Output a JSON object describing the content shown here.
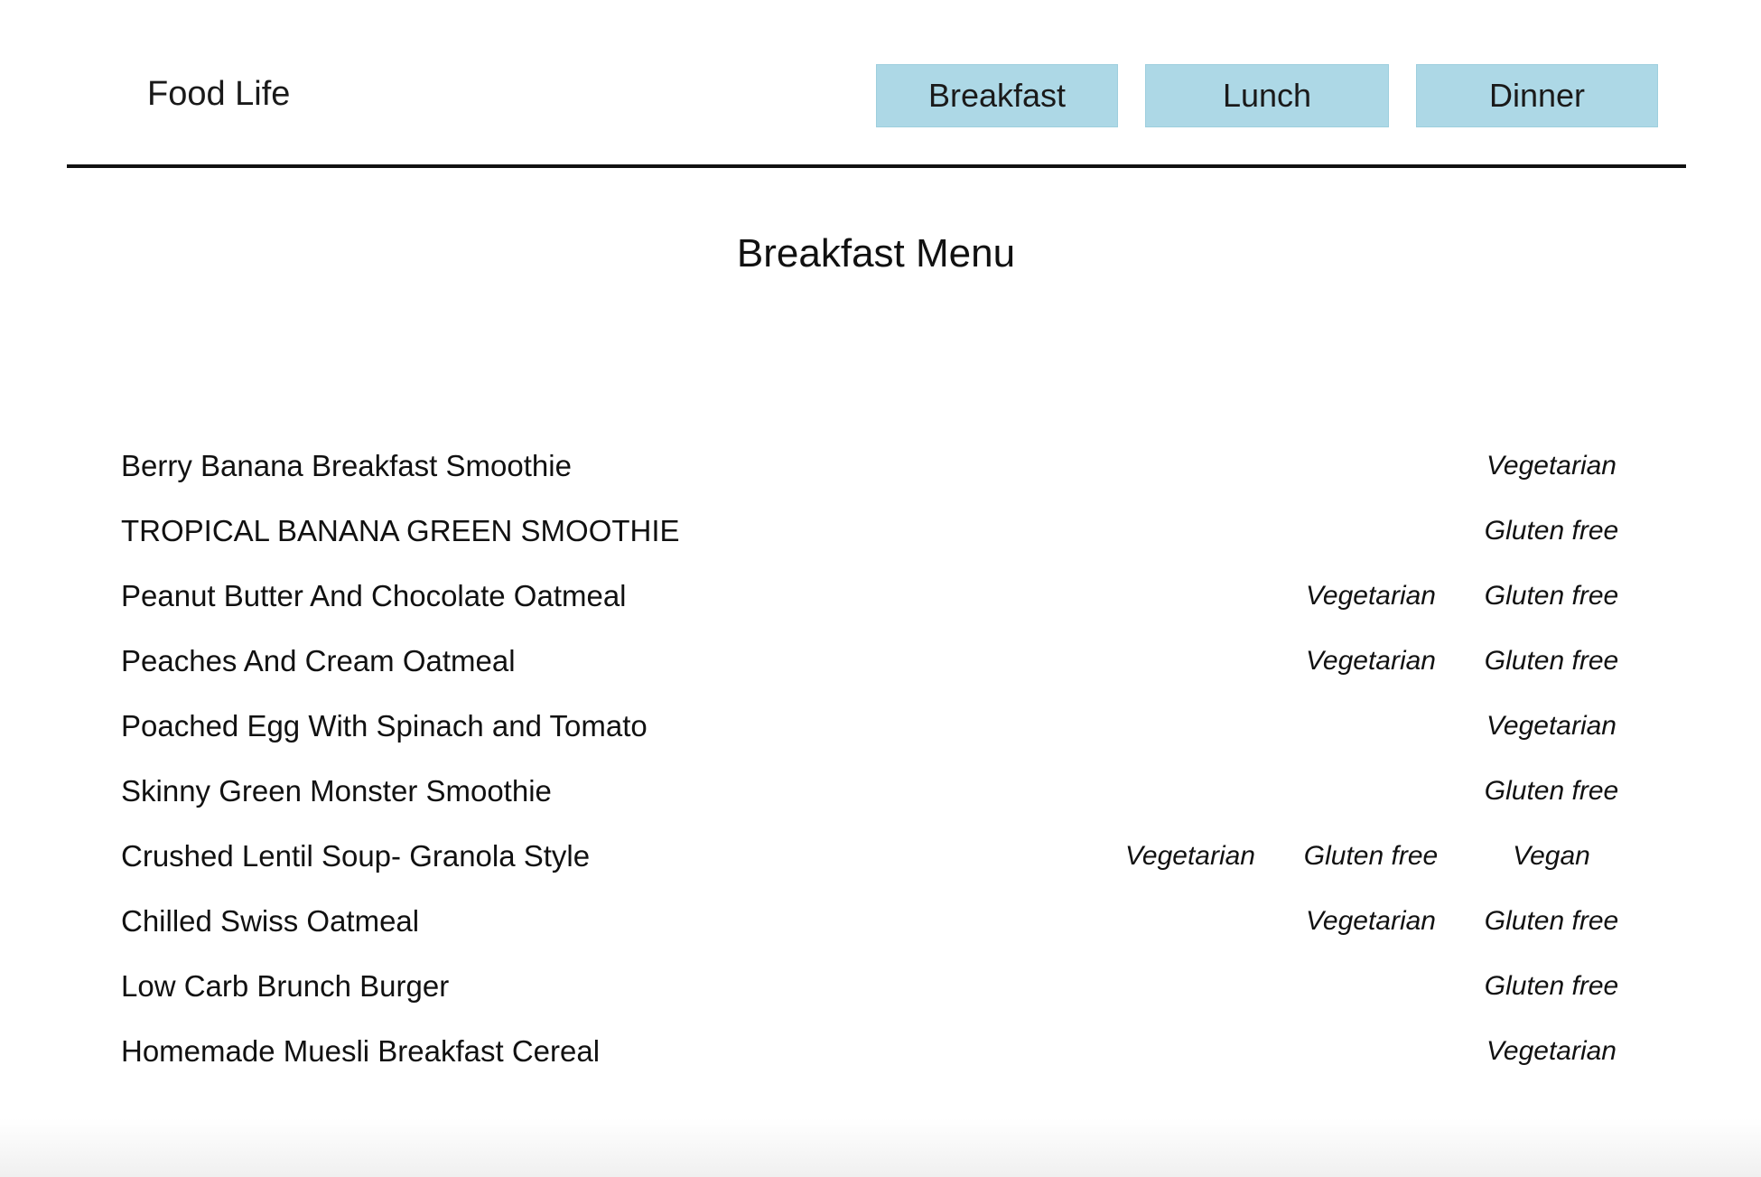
{
  "header": {
    "brand": "Food Life",
    "nav": [
      {
        "label": "Breakfast"
      },
      {
        "label": "Lunch"
      },
      {
        "label": "Dinner"
      }
    ]
  },
  "main": {
    "title": "Breakfast Menu",
    "menu_items": [
      {
        "name": "Berry Banana Breakfast Smoothie",
        "tags": [
          "Vegetarian"
        ]
      },
      {
        "name": "TROPICAL BANANA GREEN SMOOTHIE",
        "tags": [
          "Gluten free"
        ]
      },
      {
        "name": "Peanut Butter And Chocolate Oatmeal",
        "tags": [
          "Vegetarian",
          "Gluten free"
        ]
      },
      {
        "name": "Peaches And Cream Oatmeal",
        "tags": [
          "Vegetarian",
          "Gluten free"
        ]
      },
      {
        "name": "Poached Egg With Spinach and Tomato",
        "tags": [
          "Vegetarian"
        ]
      },
      {
        "name": "Skinny Green Monster Smoothie",
        "tags": [
          "Gluten free"
        ]
      },
      {
        "name": "Crushed Lentil Soup- Granola Style",
        "tags": [
          "Vegetarian",
          "Gluten free",
          "Vegan"
        ]
      },
      {
        "name": "Chilled Swiss Oatmeal",
        "tags": [
          "Vegetarian",
          "Gluten free"
        ]
      },
      {
        "name": "Low Carb Brunch Burger",
        "tags": [
          "Gluten free"
        ]
      },
      {
        "name": "Homemade Muesli Breakfast Cereal",
        "tags": [
          "Vegetarian"
        ]
      }
    ]
  },
  "colors": {
    "nav_button_background": "#add8e6",
    "divider": "#111111",
    "text": "#111111"
  }
}
